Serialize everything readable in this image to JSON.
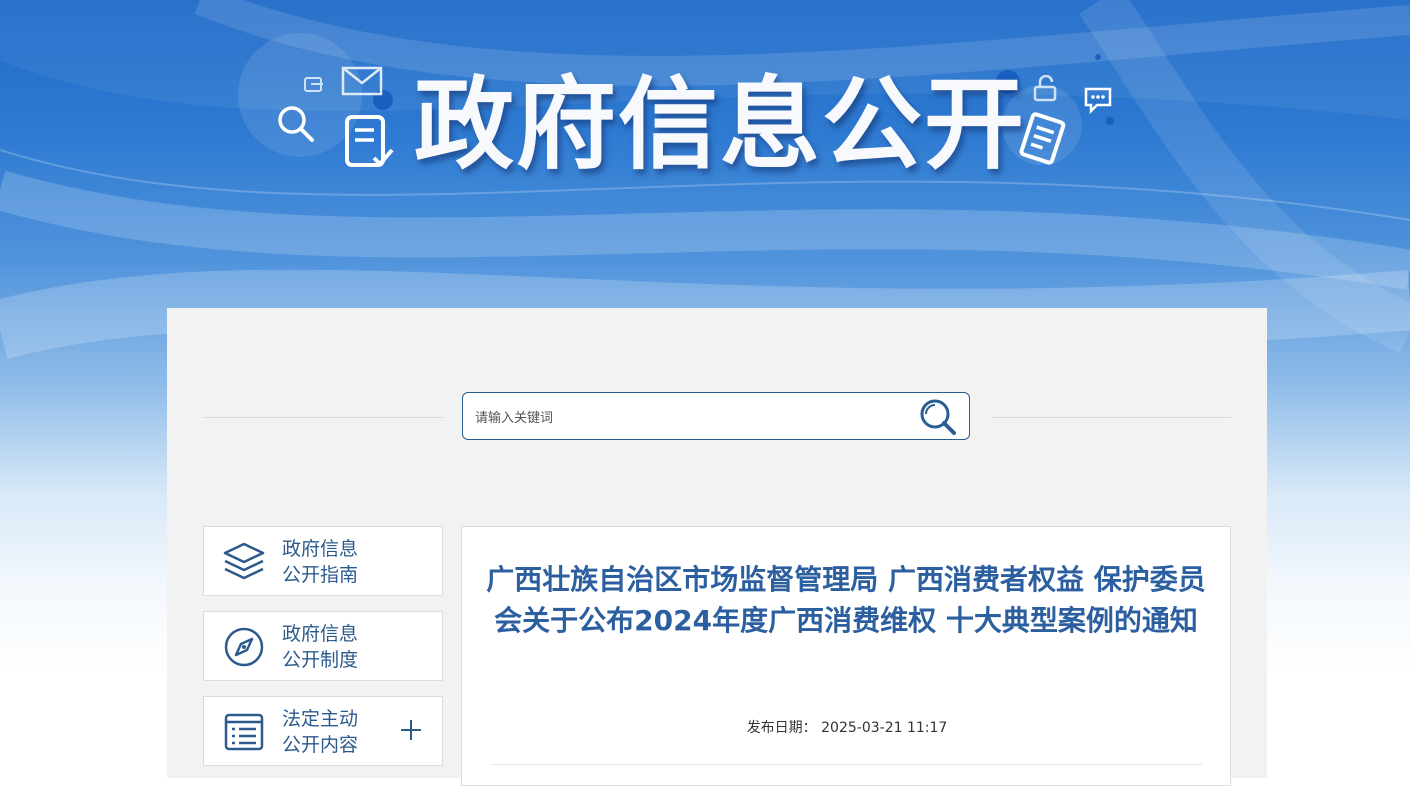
{
  "banner": {
    "title": "政府信息公开"
  },
  "search": {
    "placeholder": "请输入关键词"
  },
  "sidebar": {
    "items": [
      {
        "line1": "政府信息",
        "line2": "公开指南",
        "icon": "layers-icon"
      },
      {
        "line1": "政府信息",
        "line2": "公开制度",
        "icon": "compass-icon"
      },
      {
        "line1": "法定主动",
        "line2": "公开内容",
        "icon": "list-document-icon",
        "expand_icon": "plus-icon"
      }
    ]
  },
  "article": {
    "title": "广西壮族自治区市场监督管理局 广西消费者权益 保护委员会关于公布2024年度广西消费维权 十大典型案例的通知",
    "date_label": "发布日期：",
    "date_value": "2025-03-21 11:17"
  },
  "colors": {
    "brand_blue": "#2c5a8c",
    "title_blue": "#2c5fa0",
    "banner_blue": "#1d69c8",
    "panel_gray": "#f2f2f2"
  }
}
